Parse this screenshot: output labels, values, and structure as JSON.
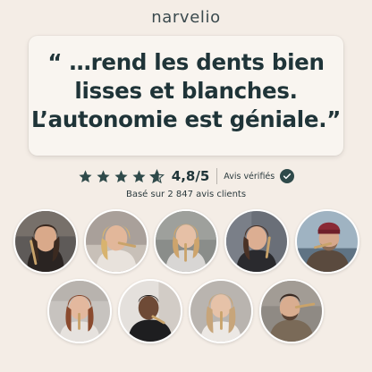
{
  "brand": {
    "name": "narvelio"
  },
  "quote": {
    "lines": [
      "“ …rend les dents bien",
      "lisses et blanches.",
      "L’autonomie est géniale.”"
    ]
  },
  "rating": {
    "score": "4,8/5",
    "stars": 4.8,
    "max_stars": 5,
    "verified_label": "Avis vérifiés",
    "based_on": "Basé sur 2 847 avis clients",
    "star_color": "#2f4a4a",
    "check_icon": "check-circle-icon"
  },
  "testimonials": {
    "row1": [
      {
        "name": "customer-photo-1"
      },
      {
        "name": "customer-photo-2"
      },
      {
        "name": "customer-photo-3"
      },
      {
        "name": "customer-photo-4"
      },
      {
        "name": "customer-photo-5"
      }
    ],
    "row2": [
      {
        "name": "customer-photo-6"
      },
      {
        "name": "customer-photo-7"
      },
      {
        "name": "customer-photo-8"
      },
      {
        "name": "customer-photo-9"
      }
    ]
  },
  "colors": {
    "background": "#f4ede6",
    "card": "#f9f5f0",
    "text": "#1f3438",
    "accent": "#2f4a4a"
  }
}
